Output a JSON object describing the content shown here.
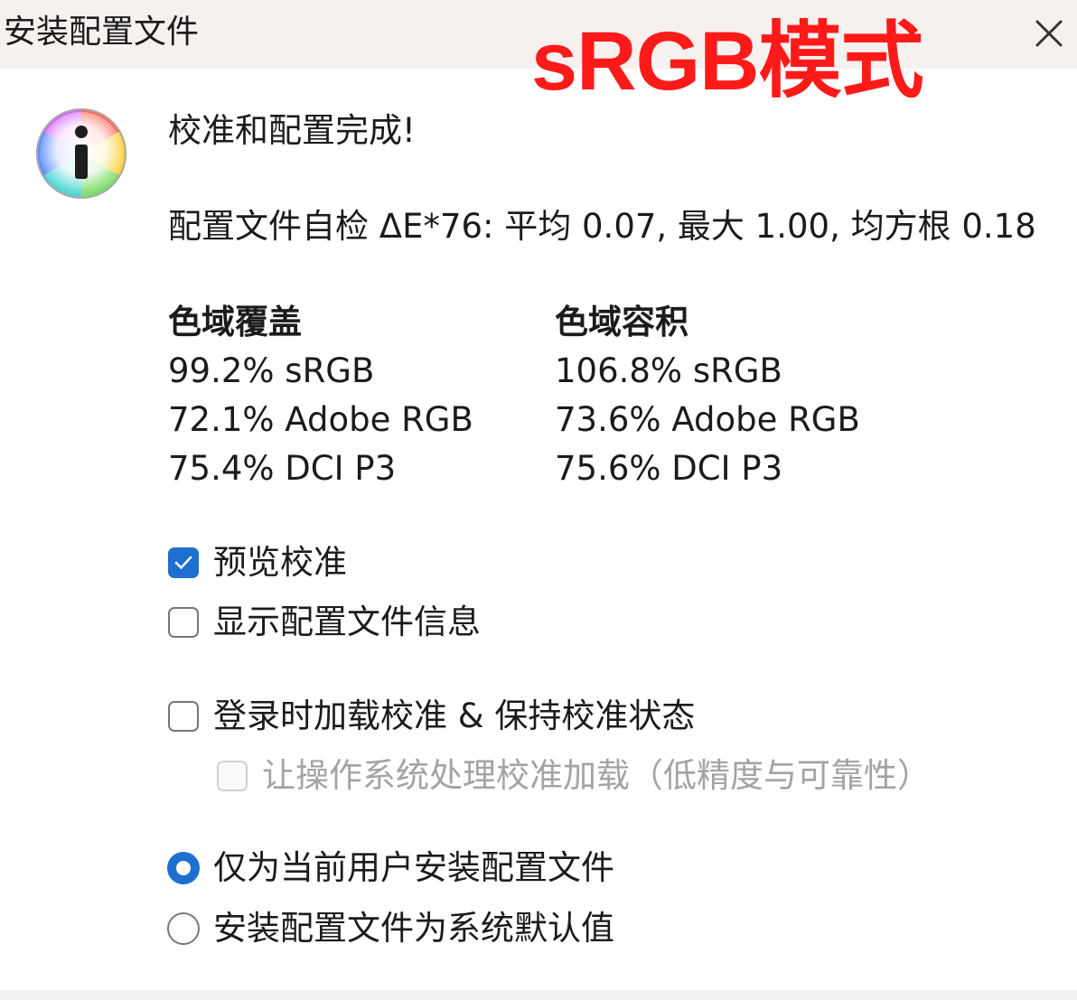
{
  "window": {
    "title": "安装配置文件",
    "close_icon": "close-icon"
  },
  "overlay": {
    "text": "sRGB模式",
    "color": "#ff1a1a"
  },
  "message": {
    "icon": "info-icon",
    "headline": "校准和配置完成!",
    "self_check": "配置文件自检 ΔE*76: 平均 0.07, 最大 1.00, 均方根 0.18"
  },
  "gamut": {
    "coverage": {
      "heading": "色域覆盖",
      "rows": [
        "99.2% sRGB",
        "72.1% Adobe RGB",
        "75.4% DCI P3"
      ]
    },
    "volume": {
      "heading": "色域容积",
      "rows": [
        "106.8% sRGB",
        "73.6% Adobe RGB",
        "75.6% DCI P3"
      ]
    }
  },
  "options": {
    "preview_calibration": {
      "label": "预览校准",
      "checked": true
    },
    "show_profile_info": {
      "label": "显示配置文件信息",
      "checked": false
    },
    "load_on_login": {
      "label": "登录时加载校准 & 保持校准状态",
      "checked": false
    },
    "os_handles_loading": {
      "label": "让操作系统处理校准加载（低精度与可靠性）",
      "checked": false,
      "disabled": true
    }
  },
  "install_scope": {
    "current_user": {
      "label": "仅为当前用户安装配置文件",
      "selected": true
    },
    "system_default": {
      "label": "安装配置文件为系统默认值",
      "selected": false
    }
  },
  "colors": {
    "accent": "#1d6fd0",
    "title_bar": "#f6f1ef"
  }
}
